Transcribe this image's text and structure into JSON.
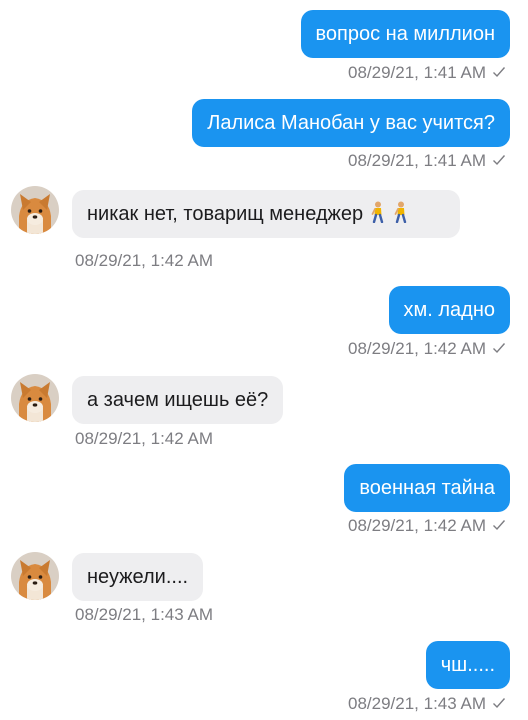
{
  "messages": [
    {
      "side": "out",
      "text": "вопрос на миллион",
      "time": "08/29/21, 1:41 AM"
    },
    {
      "side": "out",
      "text": "Лалиса Манобан у вас учится?",
      "time": "08/29/21, 1:41 AM"
    },
    {
      "side": "in",
      "text": "никак нет, товарищ менеджер",
      "time": "08/29/21, 1:42 AM",
      "trailing_icons": [
        "person-walking-icon",
        "person-walking-icon"
      ]
    },
    {
      "side": "out",
      "text": "хм. ладно",
      "time": "08/29/21, 1:42 AM"
    },
    {
      "side": "in",
      "text": "а зачем ищешь её?",
      "time": "08/29/21, 1:42 AM"
    },
    {
      "side": "out",
      "text": "военная тайна",
      "time": "08/29/21, 1:42 AM"
    },
    {
      "side": "in",
      "text": "неужели....",
      "time": "08/29/21, 1:43 AM"
    },
    {
      "side": "out",
      "text": "чш.....",
      "time": "08/29/21, 1:43 AM"
    }
  ],
  "colors": {
    "outgoing_bubble": "#1a94f0",
    "incoming_bubble": "#eeeef0",
    "timestamp": "#7d7d82"
  },
  "icons": {
    "read_receipt": "checkmark-icon",
    "avatar": "shiba-dog-avatar"
  }
}
